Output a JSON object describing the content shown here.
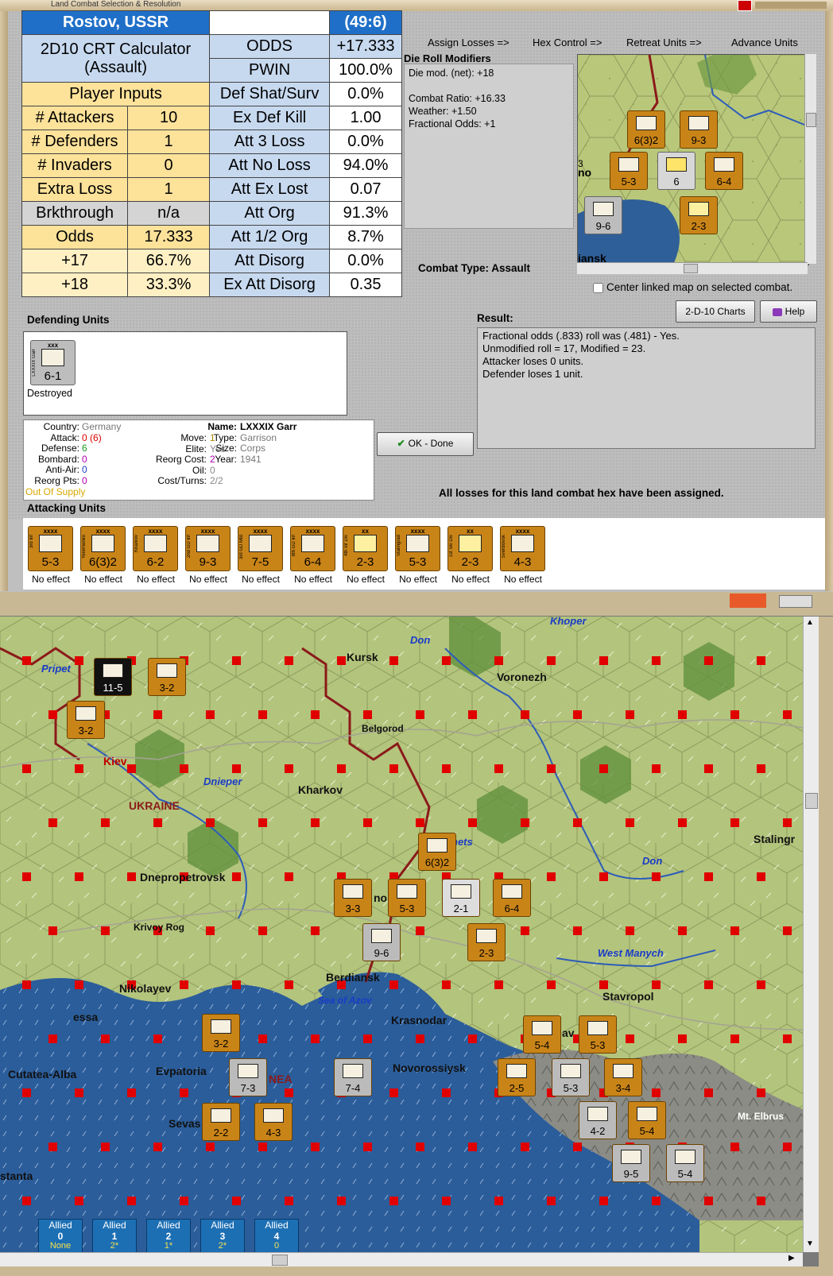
{
  "window": {
    "title": "Land Combat Selection & Resolution"
  },
  "crt": {
    "location": "Rostov, USSR",
    "coords": "(49:6)",
    "calc_title_1": "2D10 CRT Calculator",
    "calc_title_2": "(Assault)",
    "player_inputs": "Player Inputs",
    "rows_left": [
      {
        "label": "# Attackers",
        "value": "10"
      },
      {
        "label": "# Defenders",
        "value": "1"
      },
      {
        "label": "# Invaders",
        "value": "0"
      },
      {
        "label": "Extra Loss",
        "value": "1"
      },
      {
        "label": "Brkthrough",
        "value": "n/a"
      },
      {
        "label": "Odds",
        "value": "17.333"
      },
      {
        "label": "+17",
        "value": "66.7%"
      },
      {
        "label": "+18",
        "value": "33.3%"
      }
    ],
    "rows_right": [
      {
        "label": "ODDS",
        "value": "+17.333"
      },
      {
        "label": "PWIN",
        "value": "100.0%"
      },
      {
        "label": "Def Shat/Surv",
        "value": "0.0%"
      },
      {
        "label": "Ex Def Kill",
        "value": "1.00"
      },
      {
        "label": "Att 3 Loss",
        "value": "0.0%"
      },
      {
        "label": "Att No Loss",
        "value": "94.0%"
      },
      {
        "label": "Att Ex Lost",
        "value": "0.07"
      },
      {
        "label": "Att Org",
        "value": "91.3%"
      },
      {
        "label": "Att 1/2 Org",
        "value": "8.7%"
      },
      {
        "label": "Att Disorg",
        "value": "0.0%"
      },
      {
        "label": "Ex Att Disorg",
        "value": "0.35"
      }
    ]
  },
  "nav": {
    "assign_losses": "Assign Losses =>",
    "hex_control": "Hex Control =>",
    "retreat_units": "Retreat Units =>",
    "advance_units": "Advance Units"
  },
  "die_roll": {
    "label": "Die Roll Modifiers",
    "net": "Die mod. (net): +18",
    "combat_ratio": "Combat Ratio: +16.33",
    "weather": "Weather: +1.50",
    "fractional": "Fractional Odds: +1"
  },
  "combat_type": "Combat Type:  Assault",
  "center_linked": "Center linked map on selected combat.",
  "buttons": {
    "charts": "2-D-10 Charts",
    "help": "Help",
    "ok": "OK - Done"
  },
  "result": {
    "label": "Result:",
    "lines": [
      "Fractional odds (.833) roll was (.481)  - Yes.",
      "Unmodified roll = 17, Modified = 23.",
      "Attacker loses 0 units.",
      "Defender loses 1 unit."
    ]
  },
  "defending": {
    "label": "Defending Units",
    "unit": {
      "size": "xxx",
      "side": "LXXXIX Garr",
      "strength": "6-1",
      "status": "Destroyed"
    }
  },
  "unit_info": {
    "country_label": "Country:",
    "country": "Germany",
    "attack_label": "Attack:",
    "attack": "0",
    "attack_paren": "(6)",
    "defense_label": "Defense:",
    "defense": "6",
    "bombard_label": "Bombard:",
    "bombard": "0",
    "antiair_label": "Anti-Air:",
    "antiair": "0",
    "reorg_pts_label": "Reorg Pts:",
    "reorg_pts": "0",
    "supply": "Out Of Supply",
    "move_label": "Move:",
    "move": "1",
    "elite_label": "Elite:",
    "elite": "Yes",
    "reorg_cost_label": "Reorg Cost:",
    "reorg_cost": "2",
    "oil_label": "Oil:",
    "oil": "0",
    "cost_turns_label": "Cost/Turns:",
    "cost_turns": "2/2",
    "name_label": "Name:",
    "name": "LXXXIX Garr",
    "type_label": "Type:",
    "type": "Garrison",
    "size_label": "Size:",
    "size": "Corps",
    "year_label": "Year:",
    "year": "1941"
  },
  "all_losses": "All losses for this land combat hex have been assigned.",
  "attacking": {
    "label": "Attacking Units",
    "units": [
      {
        "size": "xxxx",
        "side": "3rd Inf",
        "strength": "5-3",
        "effect": "No effect",
        "sym": "M"
      },
      {
        "size": "xxxx",
        "side": "Yeremenko",
        "strength": "6(3)2",
        "effect": "No effect",
        "sym": "X"
      },
      {
        "size": "xxxx",
        "side": "Kharkov",
        "strength": "6-2",
        "effect": "No effect",
        "sym": "M"
      },
      {
        "size": "xxxx",
        "side": "2nd GD Inf",
        "strength": "9-3",
        "effect": "No effect",
        "sym": "X"
      },
      {
        "size": "xxxx",
        "side": "3rd GD Mtd",
        "strength": "7-5",
        "effect": "No effect",
        "sym": "X"
      },
      {
        "size": "xxxx",
        "side": "8th GD Inf",
        "strength": "6-4",
        "effect": "No effect",
        "sym": "X"
      },
      {
        "size": "xx",
        "side": "4th Inf Div",
        "strength": "2-3",
        "effect": "No effect",
        "sym": "/"
      },
      {
        "size": "xxxx",
        "side": "Stalingrad",
        "strength": "5-3",
        "effect": "No effect",
        "sym": "M"
      },
      {
        "size": "xx",
        "side": "1st Ski Div",
        "strength": "2-3",
        "effect": "No effect",
        "sym": "/"
      },
      {
        "size": "xxxx",
        "side": "Sverdlovsk",
        "strength": "4-3",
        "effect": "No effect",
        "sym": "M"
      }
    ]
  },
  "minimap": {
    "labels": [
      "no",
      "iansk"
    ],
    "units": [
      {
        "strength": "6(3)2"
      },
      {
        "strength": "9-3"
      },
      {
        "strength": "5-3"
      },
      {
        "strength": "6"
      },
      {
        "strength": "6-4"
      },
      {
        "strength": "9-6"
      },
      {
        "strength": "2-3"
      },
      {
        "strength": "3"
      }
    ]
  },
  "map": {
    "cities": [
      {
        "name": "Kursk"
      },
      {
        "name": "Voronezh"
      },
      {
        "name": "Belgorod"
      },
      {
        "name": "Kiev"
      },
      {
        "name": "Kharkov"
      },
      {
        "name": "UKRAINE"
      },
      {
        "name": "Dnepropetrovsk"
      },
      {
        "name": "Krivoy Rog"
      },
      {
        "name": "Nikolayev"
      },
      {
        "name": "essa"
      },
      {
        "name": "Berdiansk"
      },
      {
        "name": "Krasnodar"
      },
      {
        "name": "Stavropol"
      },
      {
        "name": "Stalingr"
      },
      {
        "name": "Cutatea-Alba"
      },
      {
        "name": "Evpatoria"
      },
      {
        "name": "Novorossiysk"
      },
      {
        "name": "Sevas"
      },
      {
        "name": "stanta"
      },
      {
        "name": "Mt. Elbrus"
      },
      {
        "name": "NEA"
      },
      {
        "name": "no"
      },
      {
        "name": "av"
      }
    ],
    "rivers": [
      {
        "name": "Pripet"
      },
      {
        "name": "Don"
      },
      {
        "name": "Khoper"
      },
      {
        "name": "Dnieper"
      },
      {
        "name": "nets"
      },
      {
        "name": "Don"
      },
      {
        "name": "West Manych"
      },
      {
        "name": "Sea of Azov"
      }
    ],
    "units": [
      {
        "strength": "11-5"
      },
      {
        "strength": "3-2"
      },
      {
        "strength": "3-2"
      },
      {
        "strength": "6(3)2"
      },
      {
        "strength": "3-3"
      },
      {
        "strength": "5-3"
      },
      {
        "strength": "2-1"
      },
      {
        "strength": "6-4"
      },
      {
        "strength": "9-6"
      },
      {
        "strength": "2-3"
      },
      {
        "strength": "3-2"
      },
      {
        "strength": "7-3"
      },
      {
        "strength": "7-4"
      },
      {
        "strength": "2-2"
      },
      {
        "strength": "4-3"
      },
      {
        "strength": "5-4"
      },
      {
        "strength": "5-3"
      },
      {
        "strength": "2-5"
      },
      {
        "strength": "5-3"
      },
      {
        "strength": "3-4"
      },
      {
        "strength": "4-2"
      },
      {
        "strength": "5-4"
      },
      {
        "strength": "9-5"
      },
      {
        "strength": "5-4"
      }
    ],
    "allied": [
      {
        "label": "Allied",
        "num": "0",
        "sub": "None"
      },
      {
        "label": "Allied",
        "num": "1",
        "sub": "2*"
      },
      {
        "label": "Allied",
        "num": "2",
        "sub": "1*"
      },
      {
        "label": "Allied",
        "num": "3",
        "sub": "2*"
      },
      {
        "label": "Allied",
        "num": "4",
        "sub": "0"
      }
    ]
  },
  "colors": {
    "header_blue": "#1f6fc8",
    "soviet_counter": "#c98418",
    "axis_counter": "#bdbdbd",
    "supply_red": "#e00000",
    "sea": "#2b5d9a"
  }
}
